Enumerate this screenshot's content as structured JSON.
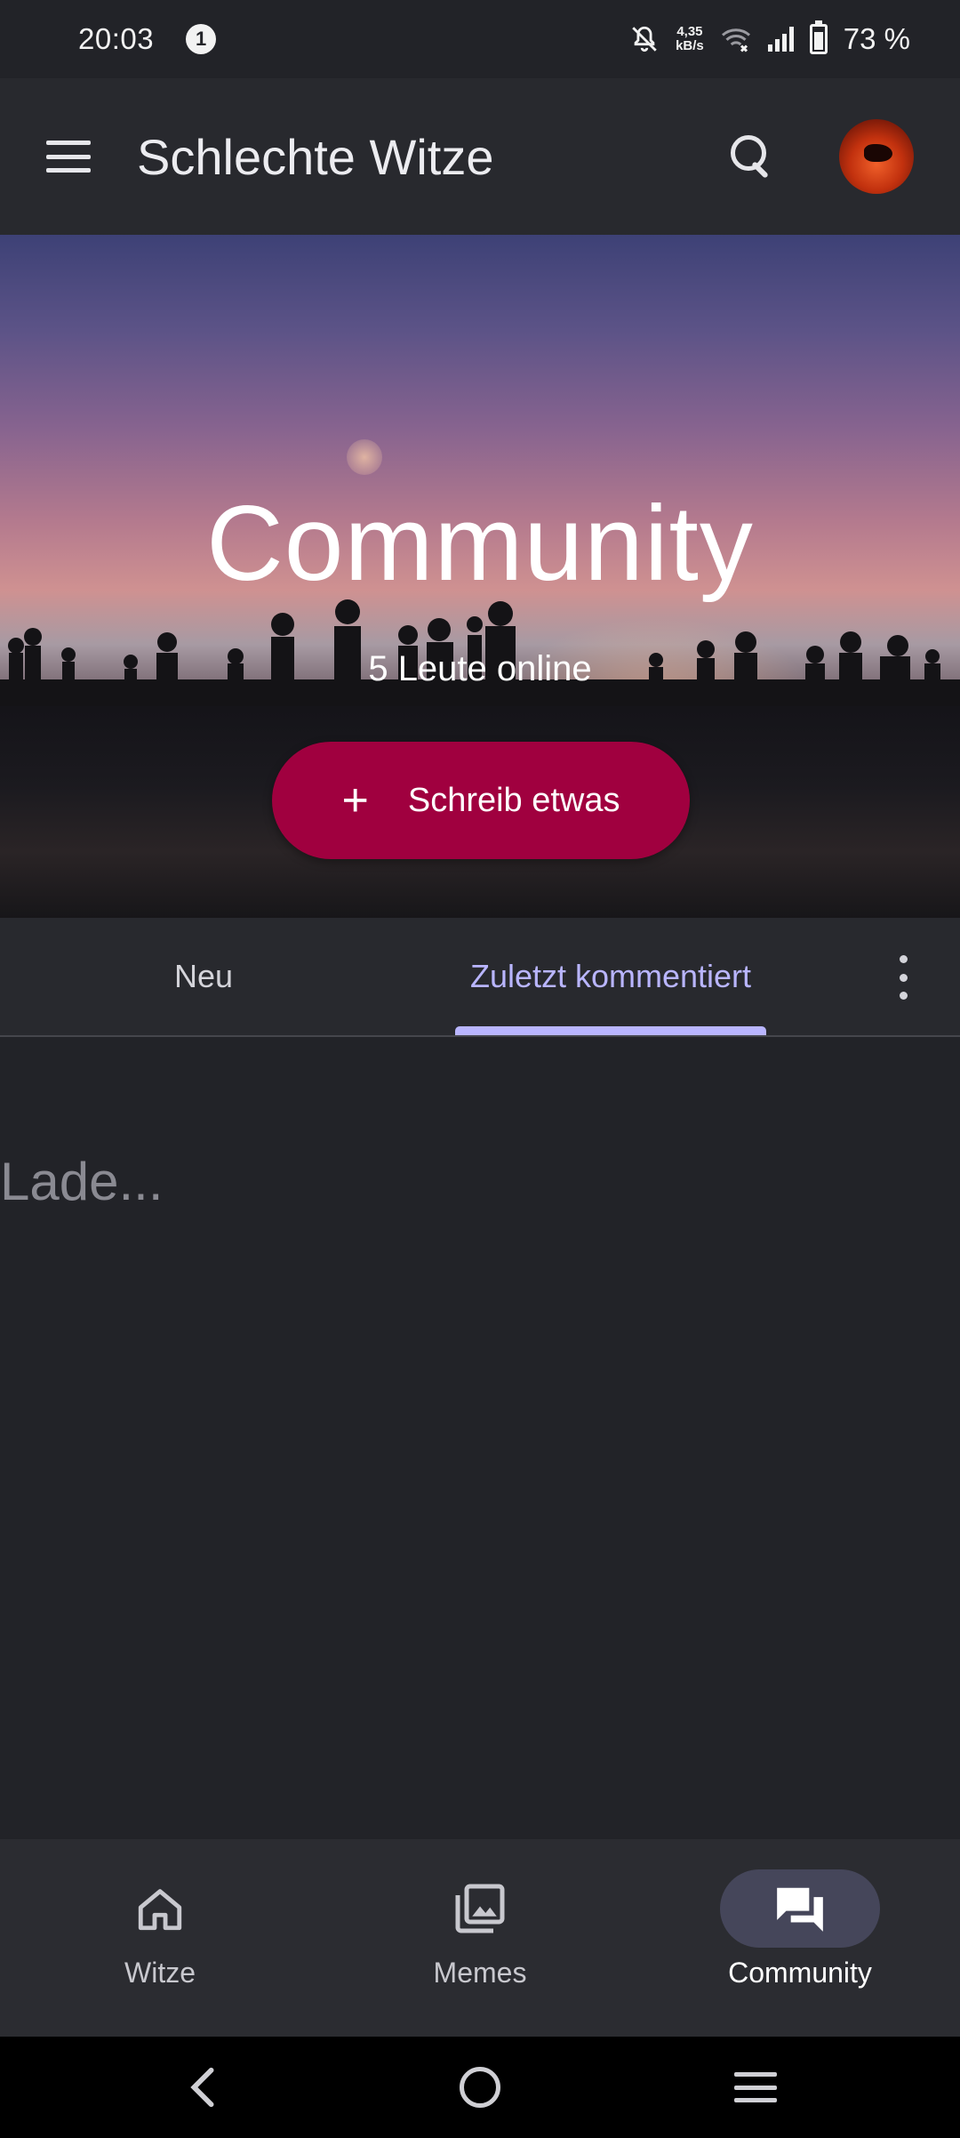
{
  "status_bar": {
    "time": "20:03",
    "notification_count": "1",
    "net_speed_value": "4,35",
    "net_speed_unit": "kB/s",
    "battery": "73 %"
  },
  "app_bar": {
    "title": "Schlechte Witze",
    "icons": [
      "menu-icon",
      "search-icon",
      "avatar"
    ]
  },
  "hero": {
    "title": "Community",
    "subtitle": "5 Leute online",
    "write_button": {
      "icon": "+",
      "label": "Schreib etwas"
    }
  },
  "tabs": {
    "items": [
      {
        "label": "Neu",
        "active": false
      },
      {
        "label": "Zuletzt kommentiert",
        "active": true
      }
    ],
    "more_icon": "more-vert-icon"
  },
  "content": {
    "loading": "Lade..."
  },
  "bottom_nav": {
    "items": [
      {
        "label": "Witze",
        "icon": "home-icon",
        "active": false
      },
      {
        "label": "Memes",
        "icon": "gallery-icon",
        "active": false
      },
      {
        "label": "Community",
        "icon": "forum-icon",
        "active": true
      }
    ]
  },
  "colors": {
    "background": "#222328",
    "app_bar": "#28292e",
    "accent_button": "#a0003f",
    "tab_active": "#b9b5ff",
    "nav_active_pill": "#45465a"
  }
}
